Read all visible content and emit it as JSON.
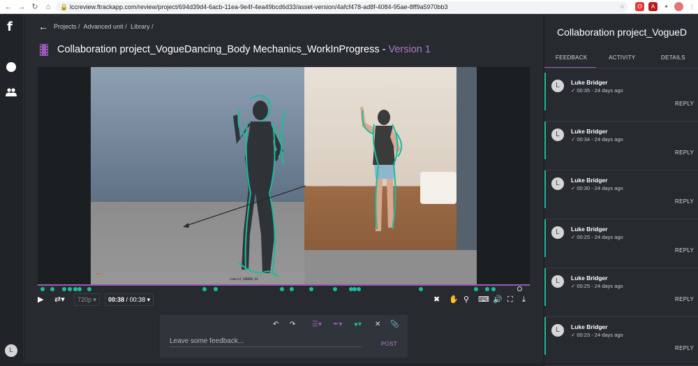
{
  "browser": {
    "url": "lccreview.ftrackapp.com/review/project/694d39d4-6acb-11ea-9e4f-4ea49bcd6d33/asset-version/4afcf478-ad8f-4084-95ae-8ff9a5970bb3"
  },
  "sidebar": {
    "logo": "f",
    "avatar_initial": "L"
  },
  "breadcrumb": [
    "Projects /",
    "Advanced unit /",
    "Library /"
  ],
  "header": {
    "title": "Collaboration project_VogueDancing_Body Mechanics_WorkInProgress - ",
    "version": "Version 1"
  },
  "viewer": {
    "camera_label": "camera1_RENDER_01"
  },
  "player": {
    "quality": "720p",
    "time_current": "00:38",
    "time_total": "00:38",
    "time_separator": "/"
  },
  "feedback": {
    "placeholder": "Leave some feedback...",
    "post_label": "POST"
  },
  "panel": {
    "title": "Collaboration project_VogueD",
    "tabs": [
      "FEEDBACK",
      "ACTIVITY",
      "DETAILS"
    ],
    "active_tab": "FEEDBACK",
    "notes": [
      {
        "author": "Luke Bridger",
        "meta": "00:35 - 24 days ago",
        "reply": "REPLY",
        "initial": "L"
      },
      {
        "author": "Luke Bridger",
        "meta": "00:34 - 24 days ago",
        "reply": "REPLY",
        "initial": "L"
      },
      {
        "author": "Luke Bridger",
        "meta": "00:30 - 24 days ago",
        "reply": "REPLY",
        "initial": "L"
      },
      {
        "author": "Luke Bridger",
        "meta": "00:25 - 24 days ago",
        "reply": "REPLY",
        "initial": "L"
      },
      {
        "author": "Luke Bridger",
        "meta": "00:25 - 24 days ago",
        "reply": "REPLY",
        "initial": "L"
      },
      {
        "author": "Luke Bridger",
        "meta": "00:23 - 24 days ago",
        "reply": "REPLY",
        "initial": "L"
      }
    ]
  },
  "colors": {
    "accent": "#9b59b6",
    "annotation": "#1abc9c",
    "background": "#272b30"
  }
}
